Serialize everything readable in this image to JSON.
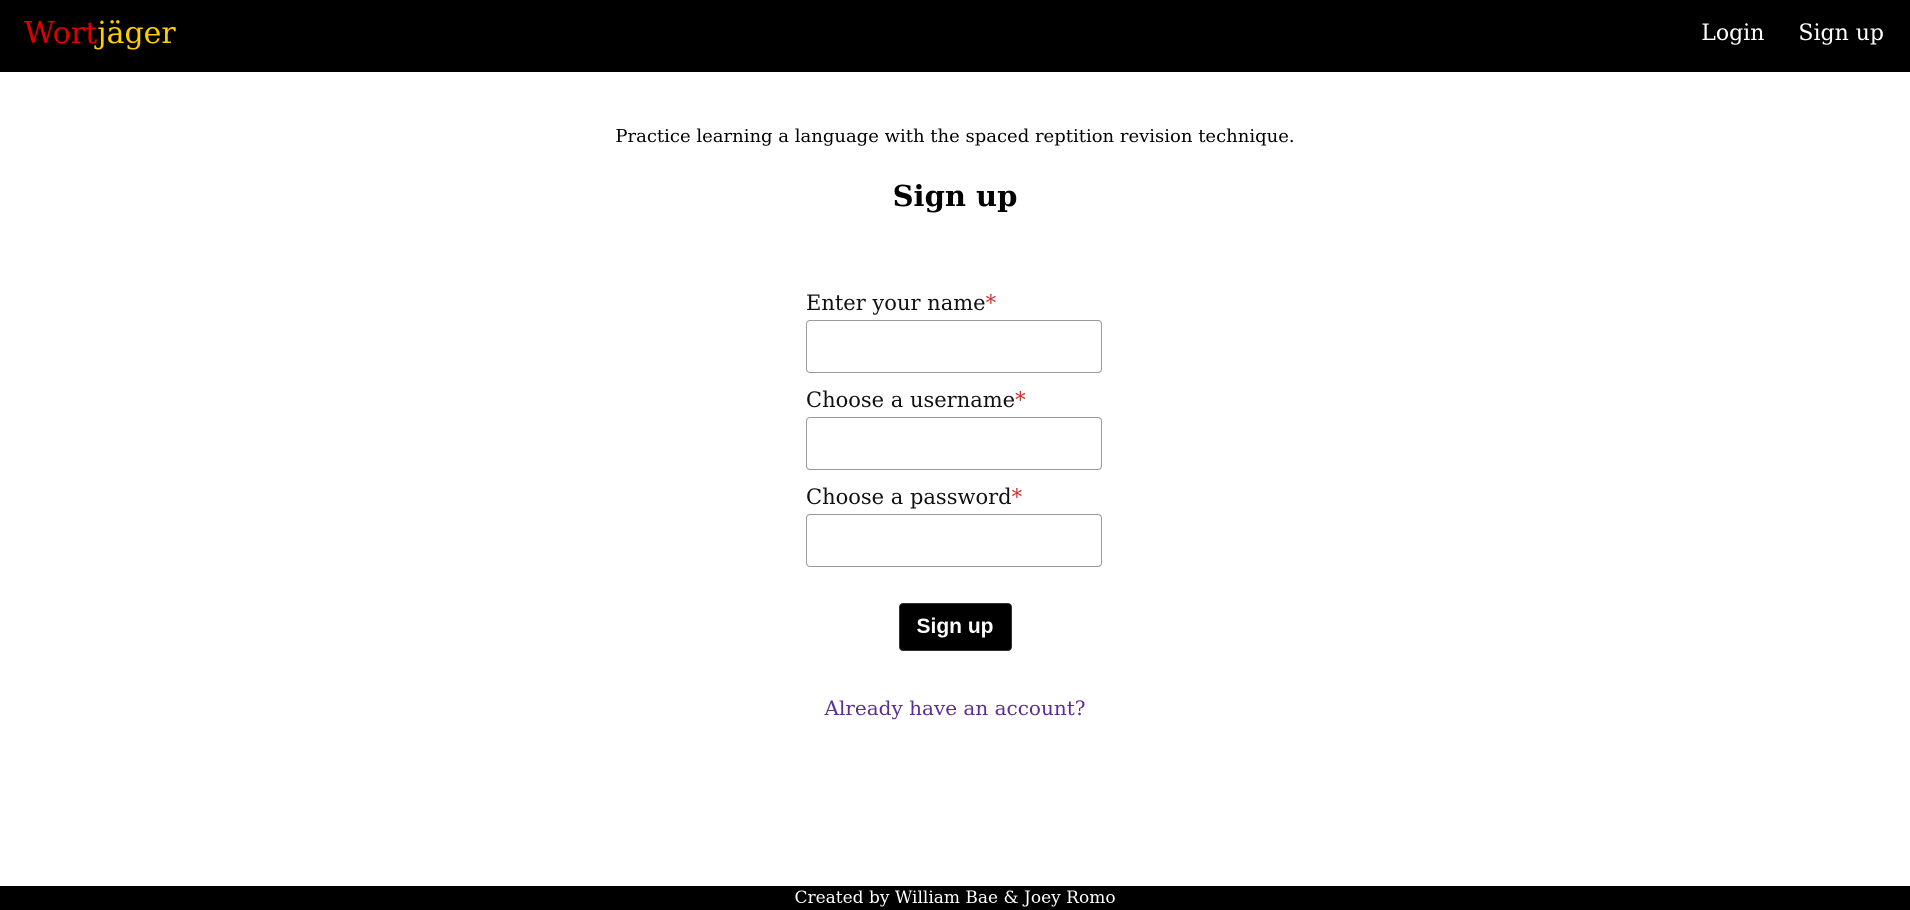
{
  "header": {
    "brand_part1": "Wort",
    "brand_part2": "jäger",
    "brand_color1": "#dd0000",
    "brand_color2": "#ffcc00",
    "nav": {
      "login_label": "Login",
      "signup_label": "Sign up"
    }
  },
  "main": {
    "tagline": "Practice learning a language with the spaced reptition revision technique.",
    "heading": "Sign up",
    "form": {
      "name_label": "Enter your name",
      "username_label": "Choose a username",
      "password_label": "Choose a password",
      "required_marker": "*",
      "name_value": "",
      "username_value": "",
      "password_value": "",
      "submit_label": "Sign up"
    },
    "signin_link": "Already have an account?"
  },
  "footer": {
    "credit": "Created by William Bae & Joey Romo"
  }
}
